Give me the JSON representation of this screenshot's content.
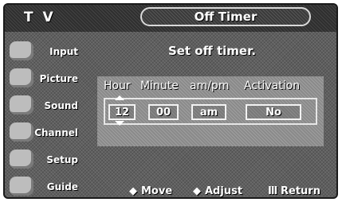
{
  "header": {
    "app_label": "T V",
    "title": "Off Timer"
  },
  "sidebar": {
    "items": [
      {
        "label": "Input",
        "icon": "input-icon"
      },
      {
        "label": "Picture",
        "icon": "picture-icon"
      },
      {
        "label": "Sound",
        "icon": "sound-icon"
      },
      {
        "label": "Channel",
        "icon": "channel-icon"
      },
      {
        "label": "Setup",
        "icon": "setup-icon"
      },
      {
        "label": "Guide",
        "icon": "guide-icon"
      }
    ]
  },
  "main": {
    "prompt": "Set off timer.",
    "columns": [
      "Hour",
      "Minute",
      "am/pm",
      "Activation"
    ],
    "values": {
      "hour": "12",
      "minute": "00",
      "ampm": "am",
      "activation": "No"
    }
  },
  "footer": {
    "move": "Move",
    "adjust": "Adjust",
    "return": "Return",
    "move_glyph": "◆",
    "adjust_glyph": "◆",
    "return_glyph": "Ⅲ"
  }
}
